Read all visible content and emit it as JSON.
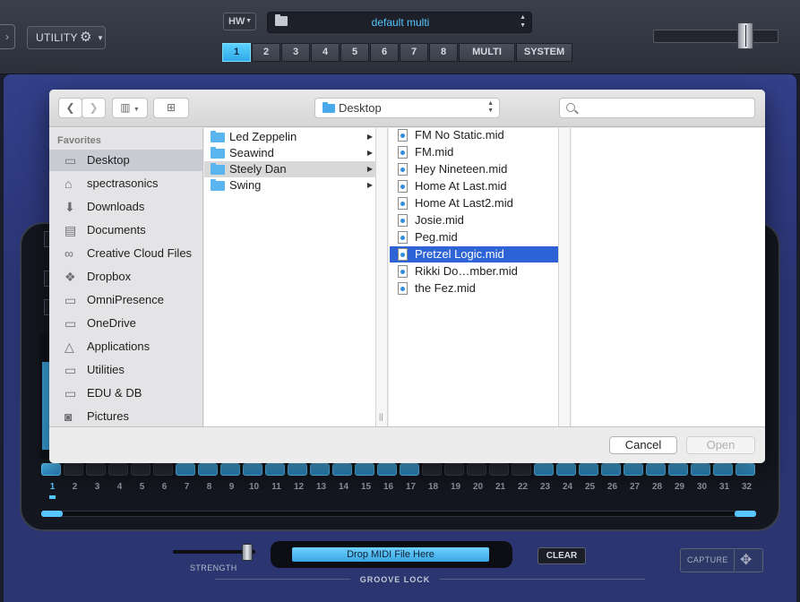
{
  "host": {
    "side_tab_glyph": "›",
    "utility_label": "UTILITY",
    "hw_label": "HW",
    "preset_name": "default multi",
    "parts": [
      "1",
      "2",
      "3",
      "4",
      "5",
      "6",
      "7",
      "8"
    ],
    "active_part": "1",
    "multi_label": "MULTI",
    "system_label": "SYSTEM",
    "master_fader_value": 0.72
  },
  "groove": {
    "strength_label": "STRENGTH",
    "strength_value": 0.9,
    "drop_label": "Drop MIDI File Here",
    "clear_label": "CLEAR",
    "groove_lock_label": "GROOVE LOCK",
    "capture_label": "CAPTURE",
    "steps": [
      "1",
      "2",
      "3",
      "4",
      "5",
      "6",
      "7",
      "8",
      "9",
      "10",
      "11",
      "12",
      "13",
      "14",
      "15",
      "16",
      "17",
      "18",
      "19",
      "20",
      "21",
      "22",
      "23",
      "24",
      "25",
      "26",
      "27",
      "28",
      "29",
      "30",
      "31",
      "32"
    ],
    "active_step_pads": [
      1,
      7,
      8,
      9,
      10,
      11,
      12,
      13,
      14,
      15,
      16,
      17,
      23,
      24,
      25,
      26,
      27,
      28,
      29,
      30,
      31,
      32
    ],
    "accent_color": "#55c6ff"
  },
  "dialog": {
    "location": "Desktop",
    "search_placeholder": "",
    "favorites_heading": "Favorites",
    "favorites": [
      {
        "label": "Desktop",
        "icon": "desktop-icon",
        "selected": true
      },
      {
        "label": "spectrasonics",
        "icon": "home-icon"
      },
      {
        "label": "Downloads",
        "icon": "downloads-icon"
      },
      {
        "label": "Documents",
        "icon": "documents-icon"
      },
      {
        "label": "Creative Cloud Files",
        "icon": "creative-cloud-icon"
      },
      {
        "label": "Dropbox",
        "icon": "dropbox-icon"
      },
      {
        "label": "OmniPresence",
        "icon": "folder-icon"
      },
      {
        "label": "OneDrive",
        "icon": "folder-icon"
      },
      {
        "label": "Applications",
        "icon": "applications-icon"
      },
      {
        "label": "Utilities",
        "icon": "folder-icon"
      },
      {
        "label": "EDU & DB",
        "icon": "folder-icon"
      },
      {
        "label": "Pictures",
        "icon": "camera-icon"
      }
    ],
    "folders": [
      {
        "label": "Led Zeppelin"
      },
      {
        "label": "Seawind"
      },
      {
        "label": "Steely Dan",
        "highlighted": true
      },
      {
        "label": "Swing"
      }
    ],
    "files": [
      {
        "label": "FM No Static.mid"
      },
      {
        "label": "FM.mid"
      },
      {
        "label": "Hey Nineteen.mid"
      },
      {
        "label": "Home At Last.mid"
      },
      {
        "label": "Home At Last2.mid"
      },
      {
        "label": "Josie.mid"
      },
      {
        "label": "Peg.mid"
      },
      {
        "label": "Pretzel Logic.mid",
        "selected": true
      },
      {
        "label": "Rikki Do…mber.mid"
      },
      {
        "label": "the Fez.mid"
      }
    ],
    "cancel_label": "Cancel",
    "open_label": "Open",
    "selection_color": "#2d63d4"
  }
}
